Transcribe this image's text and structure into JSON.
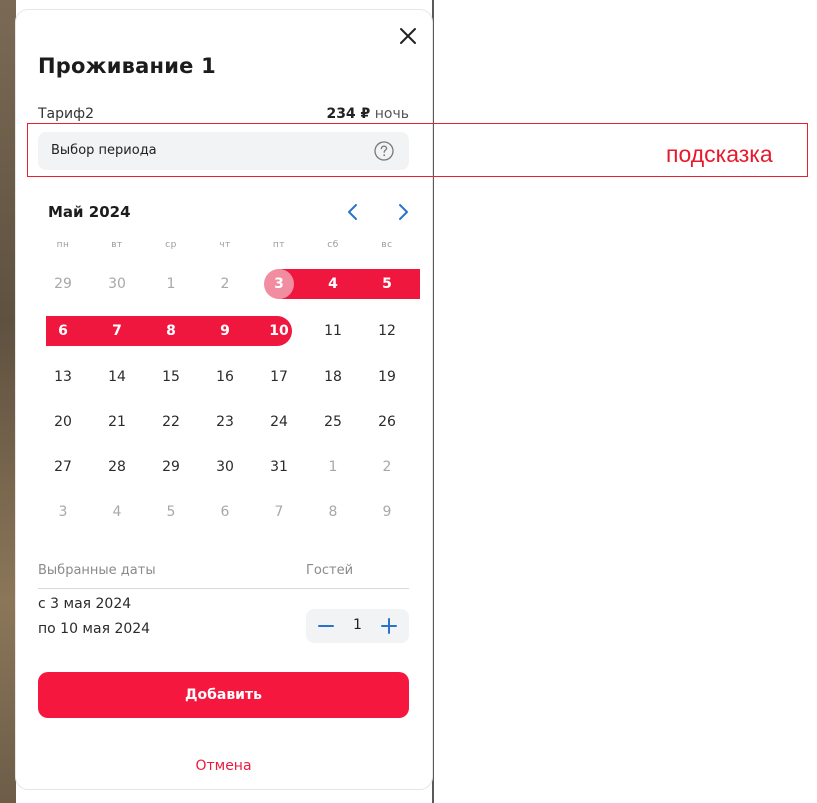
{
  "dialog": {
    "title": "Проживание 1",
    "tariff_name": "Тариф2",
    "price_amount": "234 ₽",
    "price_unit": "ночь"
  },
  "period": {
    "label": "Выбор периода",
    "help_icon": "question-circle-icon"
  },
  "annotation": {
    "text": "подсказка",
    "color": "#e8232f"
  },
  "calendar": {
    "month_label": "Май 2024",
    "weekdays": [
      "пн",
      "вт",
      "ср",
      "чт",
      "пт",
      "сб",
      "вс"
    ],
    "weeks": [
      [
        "29",
        "30",
        "1",
        "2",
        "3",
        "4",
        "5"
      ],
      [
        "6",
        "7",
        "8",
        "9",
        "10",
        "11",
        "12"
      ],
      [
        "13",
        "14",
        "15",
        "16",
        "17",
        "18",
        "19"
      ],
      [
        "20",
        "21",
        "22",
        "23",
        "24",
        "25",
        "26"
      ],
      [
        "27",
        "28",
        "29",
        "30",
        "31",
        "1",
        "2"
      ],
      [
        "3",
        "4",
        "5",
        "6",
        "7",
        "8",
        "9"
      ]
    ],
    "selected_start": "3",
    "selected_end": "10",
    "range_color": "#f0173f",
    "prev_icon": "chevron-left-icon",
    "next_icon": "chevron-right-icon"
  },
  "summary": {
    "selected_dates_label": "Выбранные даты",
    "guests_label": "Гостей",
    "date_from": "с 3 мая 2024",
    "date_to": "по 10 мая 2024",
    "guests_value": "1",
    "minus_icon": "minus-icon",
    "plus_icon": "plus-icon"
  },
  "actions": {
    "add_label": "Добавить",
    "cancel_label": "Отмена",
    "accent_color": "#f5173e"
  }
}
